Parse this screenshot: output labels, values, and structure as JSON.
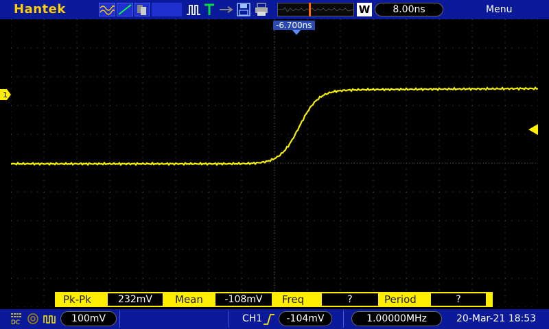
{
  "header": {
    "brand": "Hantek",
    "memory_mode": "W",
    "timebase": "8.00ns",
    "menu": "Menu"
  },
  "display": {
    "trigger_position": "-6.700ns",
    "channel_marker": "1",
    "colors": {
      "trace": "#f5f000",
      "grid": "#5a5a5a",
      "bar": "#0a1a9a"
    }
  },
  "measurements": {
    "items": [
      {
        "label": "Pk-Pk",
        "value": "232mV"
      },
      {
        "label": "Mean",
        "value": "-108mV"
      },
      {
        "label": "Freq",
        "value": "?"
      },
      {
        "label": "Period",
        "value": "?"
      }
    ]
  },
  "footer": {
    "volts_div": "100mV",
    "trigger_source": "CH1",
    "trigger_level": "-104mV",
    "trigger_freq": "1.00000MHz",
    "datetime": "20-Mar-21 18:53"
  },
  "icons": {
    "coupling": "dc-coupling-icon",
    "trigger_edge": "rising-edge-icon"
  }
}
